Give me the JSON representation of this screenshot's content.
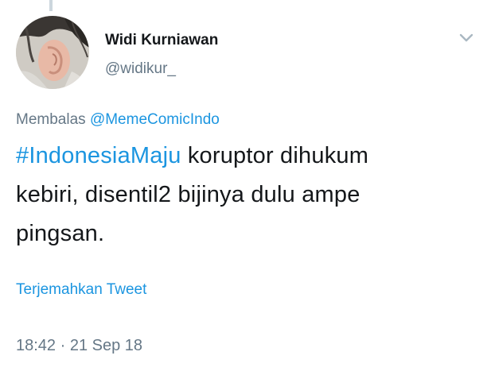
{
  "author": {
    "display_name": "Widi Kurniawan",
    "handle": "@widikur_"
  },
  "reply": {
    "prefix": "Membalas",
    "mention": "@MemeComicIndo"
  },
  "tweet": {
    "hashtag": "#IndonesiaMaju",
    "body_line1": " koruptor dihukum",
    "body_line2": "kebiri, disentil2 bijinya dulu ampe",
    "body_line3": "pingsan."
  },
  "translate_label": "Terjemahkan Tweet",
  "timestamp": "18:42 · 21 Sep 18",
  "colors": {
    "link": "#1b95e0",
    "secondary": "#657786",
    "text": "#14171a"
  },
  "icons": {
    "more_menu": "chevron-down-icon"
  }
}
